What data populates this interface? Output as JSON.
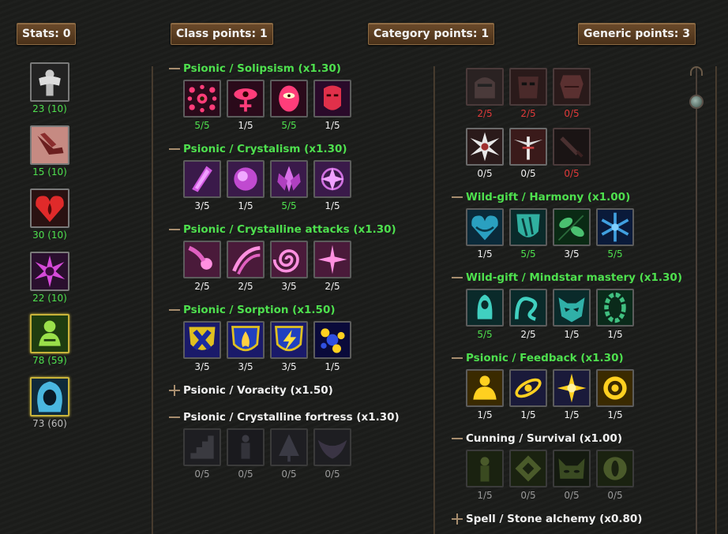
{
  "header": {
    "stats": "Stats: 0",
    "class_points": "Class points: 1",
    "category_points": "Category points: 1",
    "generic_points": "Generic points: 3"
  },
  "stats": [
    {
      "value": "23 (10)",
      "icon": "strength-icon",
      "color": "green"
    },
    {
      "value": "15 (10)",
      "icon": "dexterity-icon",
      "color": "green"
    },
    {
      "value": "30 (10)",
      "icon": "constitution-icon",
      "color": "green"
    },
    {
      "value": "22 (10)",
      "icon": "magic-icon",
      "color": "green"
    },
    {
      "value": "78 (59)",
      "icon": "willpower-icon",
      "color": "green",
      "selected": true
    },
    {
      "value": "73 (60)",
      "icon": "cunning-icon",
      "color": "gray"
    }
  ],
  "class_trees": [
    {
      "name": "Psionic / Solipsism (x1.30)",
      "state": "open",
      "color": "green",
      "talents": [
        {
          "value": "5/5",
          "c": "g",
          "icon": "many-eyes-icon"
        },
        {
          "value": "1/5",
          "c": "w",
          "icon": "venus-eye-icon"
        },
        {
          "value": "5/5",
          "c": "g",
          "icon": "eye-shield-icon"
        },
        {
          "value": "1/5",
          "c": "w",
          "icon": "mask-icon"
        }
      ]
    },
    {
      "name": "Psionic / Crystalism (x1.30)",
      "state": "open",
      "color": "green",
      "talents": [
        {
          "value": "3/5",
          "c": "w",
          "icon": "crystal-shard-icon"
        },
        {
          "value": "1/5",
          "c": "w",
          "icon": "crystal-orb-icon"
        },
        {
          "value": "5/5",
          "c": "g",
          "icon": "crystal-flower-icon"
        },
        {
          "value": "1/5",
          "c": "w",
          "icon": "crystal-burst-icon"
        }
      ]
    },
    {
      "name": "Psionic / Crystalline attacks (x1.30)",
      "state": "open",
      "color": "green",
      "talents": [
        {
          "value": "2/5",
          "c": "w",
          "icon": "comet-icon"
        },
        {
          "value": "2/5",
          "c": "w",
          "icon": "claw-slash-icon"
        },
        {
          "value": "3/5",
          "c": "w",
          "icon": "spiral-icon"
        },
        {
          "value": "2/5",
          "c": "w",
          "icon": "star-burst-icon"
        }
      ]
    },
    {
      "name": "Psionic / Sorption (x1.50)",
      "state": "open",
      "color": "green",
      "talents": [
        {
          "value": "3/5",
          "c": "w",
          "icon": "cross-shield-icon"
        },
        {
          "value": "3/5",
          "c": "w",
          "icon": "fire-shield-icon"
        },
        {
          "value": "3/5",
          "c": "w",
          "icon": "lightning-shield-icon"
        },
        {
          "value": "1/5",
          "c": "w",
          "icon": "shuriken-icon"
        }
      ]
    },
    {
      "name": "Psionic / Voracity (x1.50)",
      "state": "closed",
      "color": "white",
      "talents": []
    },
    {
      "name": "Psionic / Crystalline fortress (x1.30)",
      "state": "open",
      "color": "white",
      "talents": [
        {
          "value": "0/5",
          "c": "gr",
          "icon": "stairs-icon"
        },
        {
          "value": "0/5",
          "c": "gr",
          "icon": "figure-icon"
        },
        {
          "value": "0/5",
          "c": "gr",
          "icon": "tree-icon"
        },
        {
          "value": "0/5",
          "c": "gr",
          "icon": "bat-icon"
        }
      ]
    }
  ],
  "generic_trees": [
    {
      "name": "",
      "state": "partial",
      "talents_row1": [
        {
          "value": "2/5",
          "c": "r",
          "icon": "helmet-icon"
        },
        {
          "value": "2/5",
          "c": "r",
          "icon": "mask-helm-icon"
        },
        {
          "value": "0/5",
          "c": "r",
          "icon": "armor-icon"
        }
      ],
      "talents_row2": [
        {
          "value": "0/5",
          "c": "w",
          "icon": "swords-burst-icon"
        },
        {
          "value": "0/5",
          "c": "w",
          "icon": "winged-sword-icon"
        },
        {
          "value": "0/5",
          "c": "r",
          "icon": "dagger-icon"
        }
      ]
    },
    {
      "name": "Wild-gift / Harmony (x1.00)",
      "state": "open",
      "color": "green",
      "talents": [
        {
          "value": "1/5",
          "c": "w",
          "icon": "heart-leaf-icon"
        },
        {
          "value": "5/5",
          "c": "g",
          "icon": "nature-shield-icon"
        },
        {
          "value": "3/5",
          "c": "w",
          "icon": "leaves-icon"
        },
        {
          "value": "5/5",
          "c": "g",
          "icon": "snowflake-icon"
        }
      ]
    },
    {
      "name": "Wild-gift / Mindstar mastery (x1.30)",
      "state": "open",
      "color": "green",
      "talents": [
        {
          "value": "5/5",
          "c": "g",
          "icon": "hooded-figure-icon"
        },
        {
          "value": "2/5",
          "c": "w",
          "icon": "vines-icon"
        },
        {
          "value": "1/5",
          "c": "w",
          "icon": "beast-face-icon"
        },
        {
          "value": "1/5",
          "c": "w",
          "icon": "laurel-icon"
        }
      ]
    },
    {
      "name": "Psionic / Feedback (x1.30)",
      "state": "open",
      "color": "green",
      "talents": [
        {
          "value": "1/5",
          "c": "w",
          "icon": "meditating-icon"
        },
        {
          "value": "1/5",
          "c": "w",
          "icon": "orbit-icon"
        },
        {
          "value": "1/5",
          "c": "w",
          "icon": "sun-star-icon"
        },
        {
          "value": "1/5",
          "c": "w",
          "icon": "sun-disc-icon"
        }
      ]
    },
    {
      "name": "Cunning / Survival (x1.00)",
      "state": "open",
      "color": "white",
      "talents": [
        {
          "value": "1/5",
          "c": "gr",
          "icon": "tracker-icon"
        },
        {
          "value": "0/5",
          "c": "gr",
          "icon": "trap-icon"
        },
        {
          "value": "0/5",
          "c": "gr",
          "icon": "cat-eyes-icon"
        },
        {
          "value": "0/5",
          "c": "gr",
          "icon": "eye-icon"
        }
      ]
    },
    {
      "name": "Spell / Stone alchemy (x0.80)",
      "state": "closed",
      "color": "white",
      "talents": []
    }
  ]
}
